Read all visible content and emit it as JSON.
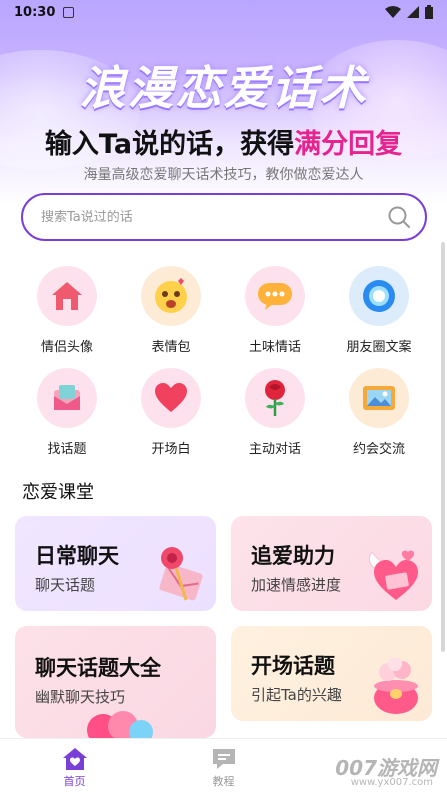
{
  "status_bar": {
    "time": "10:30"
  },
  "hero": {
    "title": "浪漫恋爱话术",
    "subtitle_main": "输入Ta说的话，获得",
    "subtitle_highlight": "满分回复",
    "description": "海量高级恋爱聊天话术技巧，教你做恋爱达人"
  },
  "search": {
    "placeholder": "搜索Ta说过的话"
  },
  "features": [
    {
      "label": "情侣头像",
      "icon": "house-icon"
    },
    {
      "label": "表情包",
      "icon": "emoji-icon"
    },
    {
      "label": "土味情话",
      "icon": "chat-bubble-icon"
    },
    {
      "label": "朋友圈文案",
      "icon": "ring-icon"
    },
    {
      "label": "找话题",
      "icon": "envelope-icon"
    },
    {
      "label": "开场白",
      "icon": "heart-icon"
    },
    {
      "label": "主动对话",
      "icon": "rose-icon"
    },
    {
      "label": "约会交流",
      "icon": "picture-icon"
    }
  ],
  "section": {
    "title": "恋爱课堂"
  },
  "cards": [
    {
      "title": "日常聊天",
      "subtitle": "聊天话题"
    },
    {
      "title": "追爱助力",
      "subtitle": "加速情感进度"
    },
    {
      "title": "聊天话题大全",
      "subtitle": "幽默聊天技巧"
    },
    {
      "title": "开场话题",
      "subtitle": "引起Ta的兴趣"
    }
  ],
  "bottom_nav": [
    {
      "label": "首页",
      "active": true
    },
    {
      "label": "教程",
      "active": false
    }
  ],
  "watermark": {
    "text": "007游戏网",
    "url": "www.yx007.com"
  }
}
